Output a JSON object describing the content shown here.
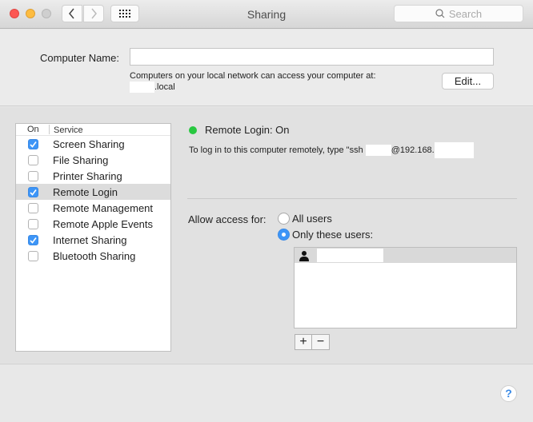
{
  "window": {
    "title": "Sharing",
    "search_placeholder": "Search",
    "icons": {
      "back": "chevron-left-icon",
      "forward": "chevron-right-icon",
      "show_all": "grid-icon",
      "search": "magnifier-icon"
    }
  },
  "computer_name": {
    "label": "Computer Name:",
    "value": "",
    "help_text": "Computers on your local network can access your computer at:",
    "local_suffix": ".local",
    "edit_button": "Edit..."
  },
  "services": {
    "columns": [
      "On",
      "Service"
    ],
    "items": [
      {
        "name": "Screen Sharing",
        "on": true,
        "selected": false
      },
      {
        "name": "File Sharing",
        "on": false,
        "selected": false
      },
      {
        "name": "Printer Sharing",
        "on": false,
        "selected": false
      },
      {
        "name": "Remote Login",
        "on": true,
        "selected": true
      },
      {
        "name": "Remote Management",
        "on": false,
        "selected": false
      },
      {
        "name": "Remote Apple Events",
        "on": false,
        "selected": false
      },
      {
        "name": "Internet Sharing",
        "on": true,
        "selected": false
      },
      {
        "name": "Bluetooth Sharing",
        "on": false,
        "selected": false
      }
    ]
  },
  "detail": {
    "status": "Remote Login: On",
    "status_color": "#28c840",
    "ssh_prefix": "To log in to this computer remotely, type \"ssh ",
    "ssh_ip_prefix": "@192.168.",
    "allow_label": "Allow access for:",
    "options": [
      {
        "label": "All users",
        "selected": false
      },
      {
        "label": "Only these users:",
        "selected": true
      }
    ],
    "users": [
      {
        "icon": "user-icon",
        "name": ""
      }
    ],
    "add_label": "+",
    "remove_label": "−"
  },
  "help_label": "?",
  "accent_color": "#3d95f7"
}
